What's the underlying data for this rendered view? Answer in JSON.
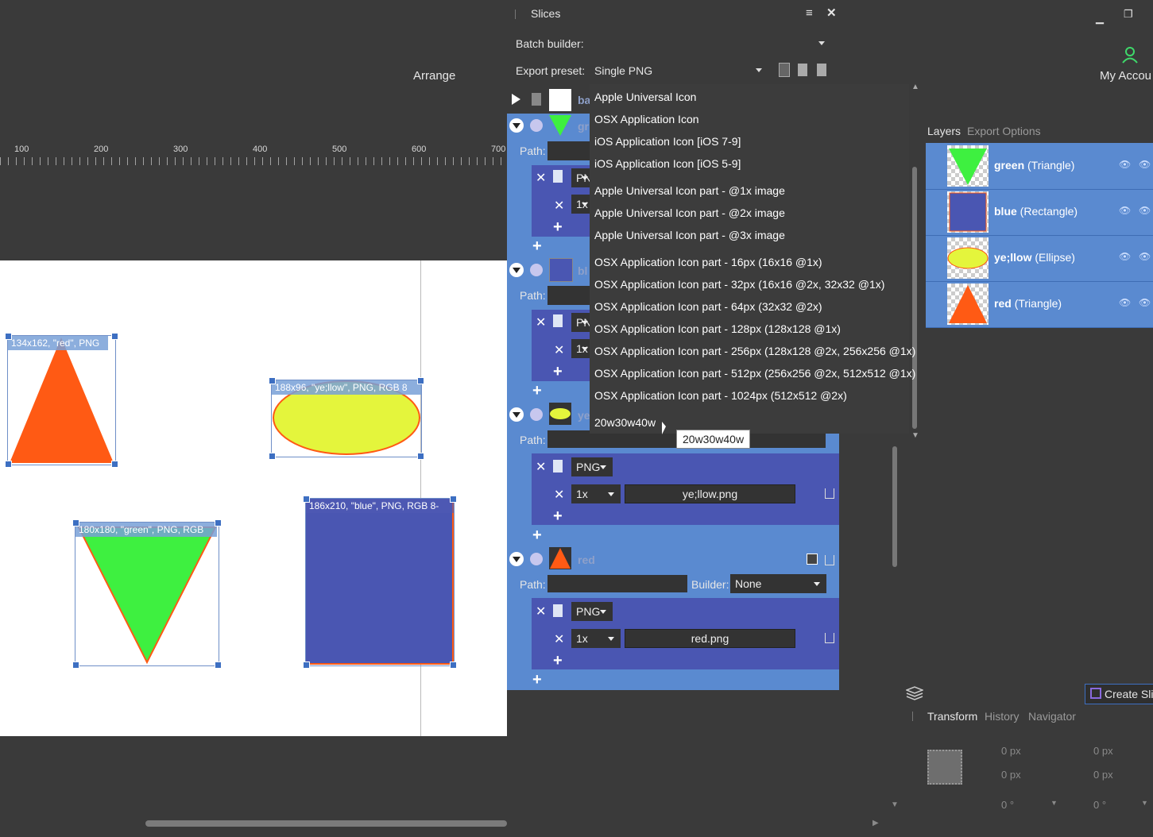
{
  "canvas": {
    "menu_label": "Arrange",
    "ruler_labels": [
      "100",
      "200",
      "300",
      "400",
      "500",
      "600",
      "700"
    ],
    "slice_labels": {
      "red": "134x162, \"red\", PNG",
      "yellow": "188x96, \"ye;llow\", PNG, RGB 8",
      "green": "180x180, \"green\", PNG, RGB",
      "blue": "186x210, \"blue\", PNG, RGB 8-"
    }
  },
  "slices_panel": {
    "title": "Slices",
    "batch_builder_label": "Batch builder:",
    "export_preset_label": "Export preset:",
    "export_preset_value": "Single PNG",
    "path_label": "Path:",
    "builder_label": "Builder:",
    "builder_value": "None",
    "slices": [
      {
        "name": "ba"
      },
      {
        "name": "gr",
        "format": "PN",
        "scale": "1x"
      },
      {
        "name": "bl",
        "format": "PN",
        "scale": "1x"
      },
      {
        "name": "ye",
        "format": "PNG",
        "scale": "1x",
        "filename": "ye;llow.png"
      },
      {
        "name": "red",
        "format": "PNG",
        "scale": "1x",
        "filename": "red.png"
      }
    ]
  },
  "preset_menu": {
    "items": [
      "Apple Universal Icon",
      "OSX Application Icon",
      "iOS Application Icon [iOS 7-9]",
      "iOS Application Icon [iOS 5-9]",
      "Apple Universal Icon part - @1x image",
      "Apple Universal Icon part - @2x image",
      "Apple Universal Icon part - @3x image",
      "OSX Application Icon part - 16px (16x16 @1x)",
      "OSX Application Icon part - 32px (16x16 @2x, 32x32 @1x)",
      "OSX Application Icon part - 64px (32x32 @2x)",
      "OSX Application Icon part - 128px (128x128 @1x)",
      "OSX Application Icon part - 256px (128x128 @2x, 256x256 @1x)",
      "OSX Application Icon part - 512px (256x256 @2x, 512x512 @1x)",
      "OSX Application Icon part - 1024px (512x512 @2x)",
      "20w30w40w"
    ],
    "tooltip": "20w30w40w"
  },
  "right": {
    "account_label": "My Accou",
    "tabs": [
      "Layers",
      "Export Options"
    ],
    "layers": [
      {
        "name": "green",
        "type": "(Triangle)"
      },
      {
        "name": "blue",
        "type": "(Rectangle)"
      },
      {
        "name": "ye;llow",
        "type": "(Ellipse)"
      },
      {
        "name": "red",
        "type": "(Triangle)"
      }
    ],
    "create_slice_label": "Create Sli",
    "bottom_tabs": [
      "Transform",
      "History",
      "Navigator"
    ],
    "transform": {
      "x": "0 px",
      "y": "0 px",
      "w": "0 px",
      "h": "0 px",
      "rot": "0 °",
      "shear": "0 °"
    }
  }
}
